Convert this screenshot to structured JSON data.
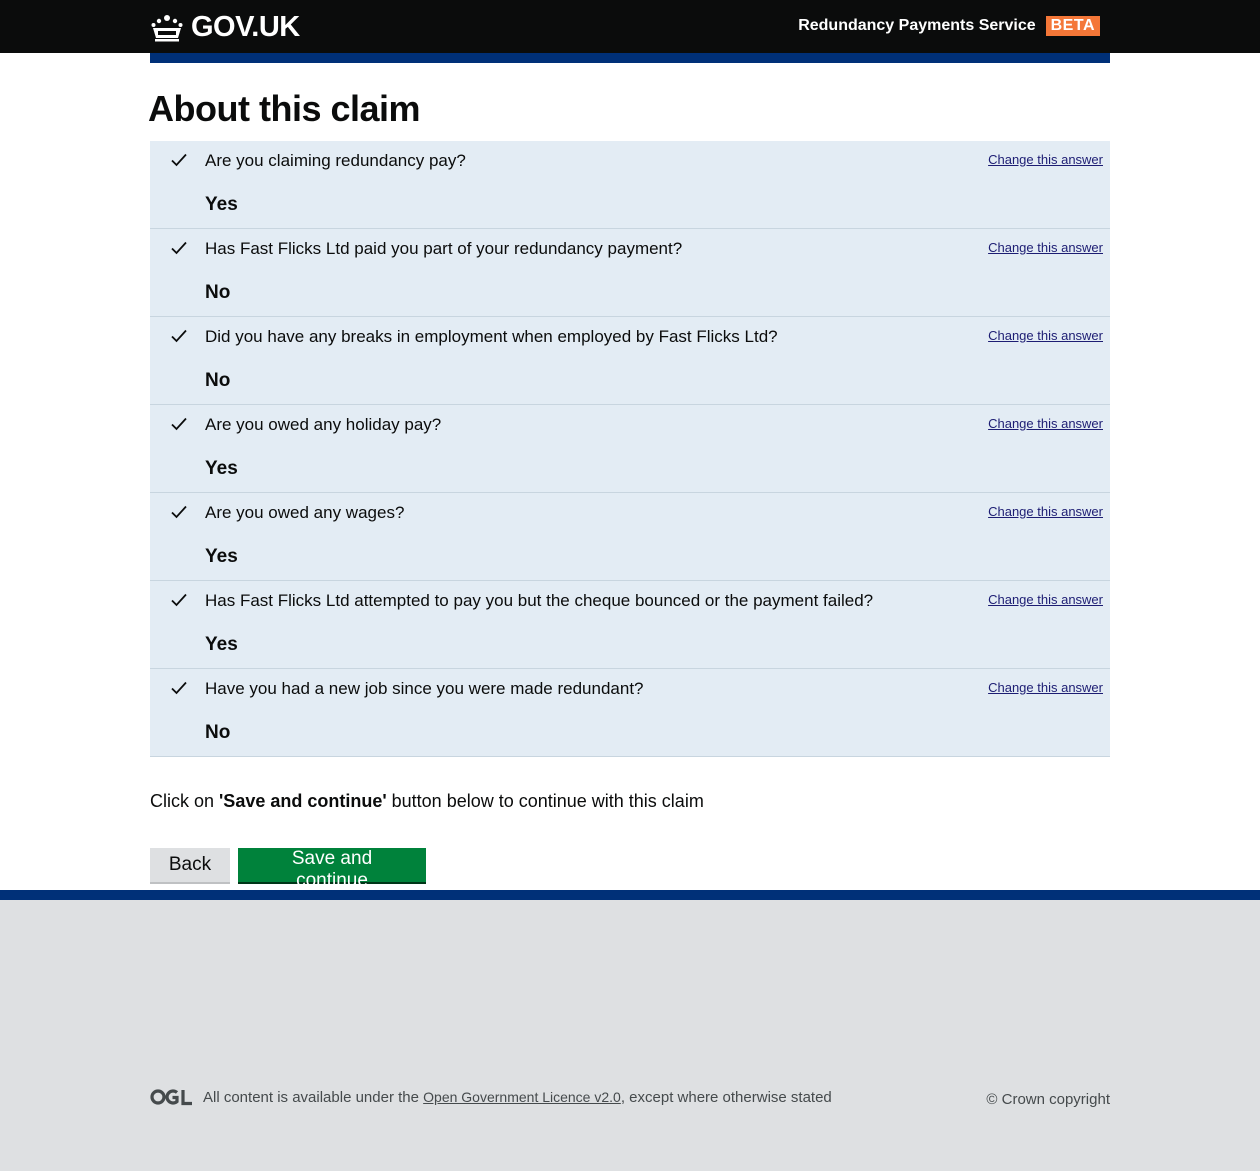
{
  "header": {
    "logo_text": "GOV.UK",
    "service_name": "Redundancy Payments Service",
    "phase_tag": "BETA"
  },
  "page": {
    "title": "About this claim"
  },
  "answers": [
    {
      "question": "Are you claiming redundancy pay?",
      "answer": "Yes",
      "change_label": "Change this answer"
    },
    {
      "question": "Has Fast Flicks Ltd paid you part of your redundancy payment?",
      "answer": "No",
      "change_label": "Change this answer"
    },
    {
      "question": "Did you have any breaks in employment when employed by Fast Flicks Ltd?",
      "answer": "No",
      "change_label": "Change this answer"
    },
    {
      "question": "Are you owed any holiday pay?",
      "answer": "Yes",
      "change_label": "Change this answer"
    },
    {
      "question": "Are you owed any wages?",
      "answer": "Yes",
      "change_label": "Change this answer"
    },
    {
      "question": "Has Fast Flicks Ltd attempted to pay you but the cheque bounced or the payment failed?",
      "answer": "Yes",
      "change_label": "Change this answer"
    },
    {
      "question": "Have you had a new job since you were made redundant?",
      "answer": "No",
      "change_label": "Change this answer"
    }
  ],
  "instruction": {
    "prefix": "Click on ",
    "emphasis": "'Save and continue'",
    "suffix": " button below to continue with this claim"
  },
  "buttons": {
    "back_label": "Back",
    "save_label": "Save and continue"
  },
  "footer": {
    "ogl_text_before": "All content is available under the ",
    "ogl_link": "Open Government Licence v2.0",
    "ogl_text_after": ", except where otherwise stated",
    "copyright": "© Crown copyright"
  },
  "colors": {
    "header_bg": "#0b0c0c",
    "beta_tag": "#f47738",
    "blue_bar": "#003078",
    "answers_bg": "#e3ecf4",
    "primary_button": "#00823b",
    "footer_bg": "#dee0e2"
  },
  "icons": {
    "logo": "crown-icon",
    "row": "check-icon",
    "footer": "ogl-logo-icon"
  }
}
